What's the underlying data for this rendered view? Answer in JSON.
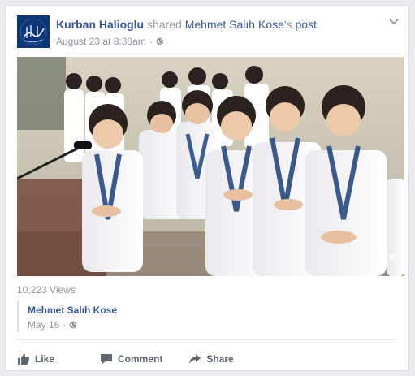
{
  "post": {
    "sharer_name": "Kurban Halioglu",
    "shared_text": "shared",
    "original_author_name": "Mehmet Salıh Kose",
    "possessive": "'s",
    "post_link": "post",
    "period": ".",
    "timestamp": "August 23 at 8:38am",
    "separator": "·",
    "privacy_icon": "globe-icon",
    "menu_icon": "chevron-down-icon"
  },
  "video": {
    "mute_icon": "muted-speaker-icon"
  },
  "stats": {
    "views": "10,223 Views"
  },
  "original_post": {
    "author": "Mehmet Salıh Kose",
    "date": "May 16",
    "separator": "·"
  },
  "actions": {
    "like": "Like",
    "comment": "Comment",
    "share": "Share"
  },
  "colors": {
    "link": "#365899",
    "muted": "#90949c",
    "action": "#606770"
  }
}
